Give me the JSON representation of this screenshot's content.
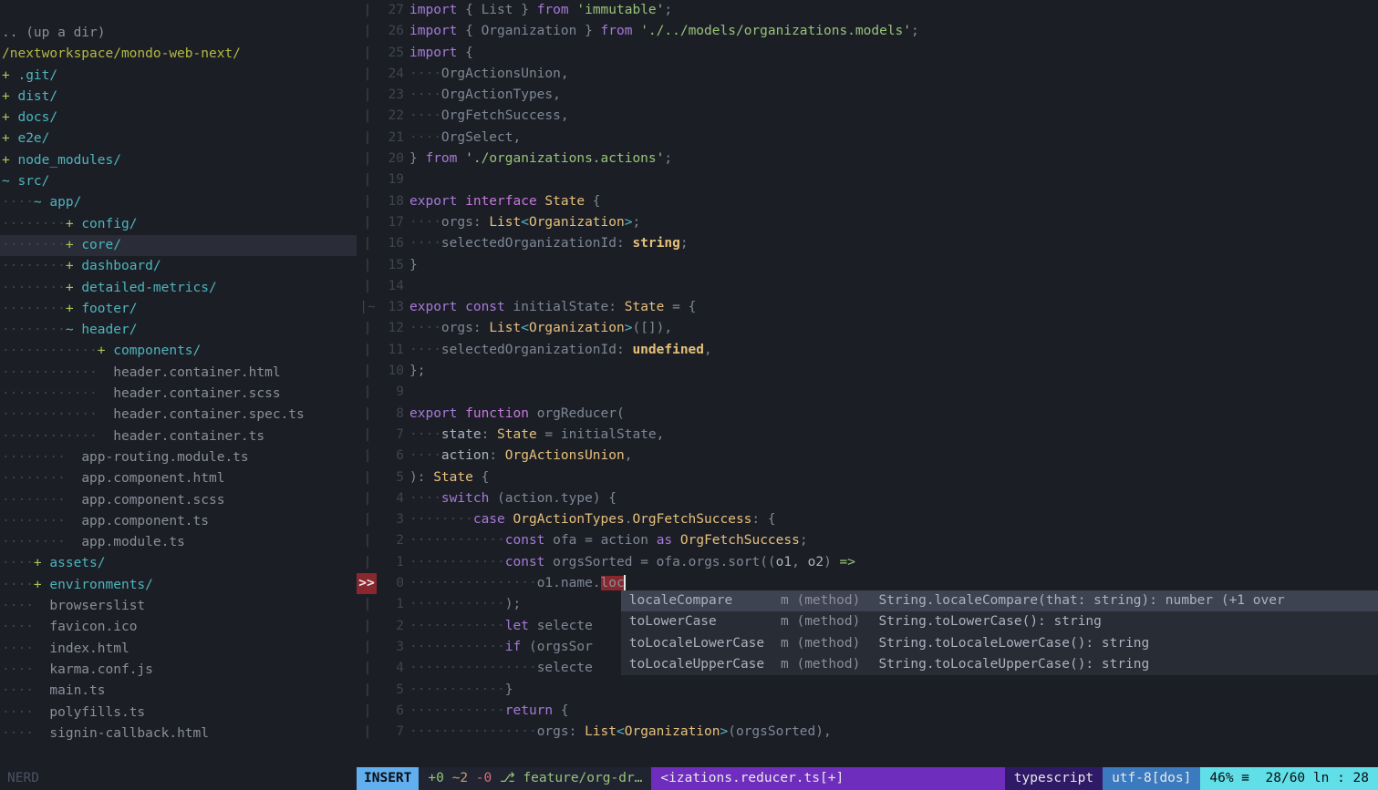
{
  "tree": {
    "updir": ".. (up a dir)",
    "root": "/nextworkspace/mondo-web-next/",
    "items": [
      {
        "indent": 0,
        "mark": "+",
        "name": ".git",
        "suffix": "/",
        "type": "dir"
      },
      {
        "indent": 0,
        "mark": "+",
        "name": "dist",
        "suffix": "/",
        "type": "dir"
      },
      {
        "indent": 0,
        "mark": "+",
        "name": "docs",
        "suffix": "/",
        "type": "dir"
      },
      {
        "indent": 0,
        "mark": "+",
        "name": "e2e",
        "suffix": "/",
        "type": "dir"
      },
      {
        "indent": 0,
        "mark": "+",
        "name": "node_modules",
        "suffix": "/",
        "type": "dir"
      },
      {
        "indent": 0,
        "mark": "~",
        "name": "src",
        "suffix": "/",
        "type": "dir-open"
      },
      {
        "indent": 1,
        "mark": "~",
        "name": "app",
        "suffix": "/",
        "type": "dir-open"
      },
      {
        "indent": 2,
        "mark": "+",
        "name": "config",
        "suffix": "/",
        "type": "dir"
      },
      {
        "indent": 2,
        "mark": "+",
        "name": "core",
        "suffix": "/",
        "type": "dir",
        "selected": true
      },
      {
        "indent": 2,
        "mark": "+",
        "name": "dashboard",
        "suffix": "/",
        "type": "dir"
      },
      {
        "indent": 2,
        "mark": "+",
        "name": "detailed-metrics",
        "suffix": "/",
        "type": "dir"
      },
      {
        "indent": 2,
        "mark": "+",
        "name": "footer",
        "suffix": "/",
        "type": "dir"
      },
      {
        "indent": 2,
        "mark": "~",
        "name": "header",
        "suffix": "/",
        "type": "dir-open"
      },
      {
        "indent": 3,
        "mark": "+",
        "name": "components",
        "suffix": "/",
        "type": "dir"
      },
      {
        "indent": 3,
        "mark": "",
        "name": "header.container.html",
        "suffix": "",
        "type": "file"
      },
      {
        "indent": 3,
        "mark": "",
        "name": "header.container.scss",
        "suffix": "",
        "type": "file"
      },
      {
        "indent": 3,
        "mark": "",
        "name": "header.container.spec.ts",
        "suffix": "",
        "type": "file"
      },
      {
        "indent": 3,
        "mark": "",
        "name": "header.container.ts",
        "suffix": "",
        "type": "file"
      },
      {
        "indent": 2,
        "mark": "",
        "name": "app-routing.module.ts",
        "suffix": "",
        "type": "file"
      },
      {
        "indent": 2,
        "mark": "",
        "name": "app.component.html",
        "suffix": "",
        "type": "file"
      },
      {
        "indent": 2,
        "mark": "",
        "name": "app.component.scss",
        "suffix": "",
        "type": "file"
      },
      {
        "indent": 2,
        "mark": "",
        "name": "app.component.ts",
        "suffix": "",
        "type": "file"
      },
      {
        "indent": 2,
        "mark": "",
        "name": "app.module.ts",
        "suffix": "",
        "type": "file"
      },
      {
        "indent": 1,
        "mark": "+",
        "name": "assets",
        "suffix": "/",
        "type": "dir"
      },
      {
        "indent": 1,
        "mark": "+",
        "name": "environments",
        "suffix": "/",
        "type": "dir"
      },
      {
        "indent": 1,
        "mark": "",
        "name": "browserslist",
        "suffix": "",
        "type": "file"
      },
      {
        "indent": 1,
        "mark": "",
        "name": "favicon.ico",
        "suffix": "",
        "type": "file"
      },
      {
        "indent": 1,
        "mark": "",
        "name": "index.html",
        "suffix": "",
        "type": "file"
      },
      {
        "indent": 1,
        "mark": "",
        "name": "karma.conf.js",
        "suffix": "",
        "type": "file"
      },
      {
        "indent": 1,
        "mark": "",
        "name": "main.ts",
        "suffix": "",
        "type": "file"
      },
      {
        "indent": 1,
        "mark": "",
        "name": "polyfills.ts",
        "suffix": "",
        "type": "file"
      },
      {
        "indent": 1,
        "mark": "",
        "name": "signin-callback.html",
        "suffix": "",
        "type": "file"
      }
    ]
  },
  "code": {
    "lines": [
      {
        "sign": "|",
        "num": "27",
        "tokens": [
          [
            "kw-import",
            "import "
          ],
          [
            "punct",
            "{ "
          ],
          [
            "ident",
            "List"
          ],
          [
            "punct",
            " } "
          ],
          [
            "kw-from",
            "from "
          ],
          [
            "string",
            "'immutable'"
          ],
          [
            "punct",
            ";"
          ]
        ]
      },
      {
        "sign": "|",
        "num": "26",
        "tokens": [
          [
            "kw-import",
            "import "
          ],
          [
            "punct",
            "{ "
          ],
          [
            "ident",
            "Organization"
          ],
          [
            "punct",
            " } "
          ],
          [
            "kw-from",
            "from "
          ],
          [
            "string",
            "'./../models/organizations.models'"
          ],
          [
            "punct",
            ";"
          ]
        ]
      },
      {
        "sign": "|",
        "num": "25",
        "tokens": [
          [
            "kw-import",
            "import "
          ],
          [
            "punct",
            "{"
          ]
        ]
      },
      {
        "sign": "|",
        "num": "24",
        "tokens": [
          [
            "lead",
            "····"
          ],
          [
            "ident",
            "OrgActionsUnion"
          ],
          [
            "punct",
            ","
          ]
        ]
      },
      {
        "sign": "|",
        "num": "23",
        "tokens": [
          [
            "lead",
            "····"
          ],
          [
            "ident",
            "OrgActionTypes"
          ],
          [
            "punct",
            ","
          ]
        ]
      },
      {
        "sign": "|",
        "num": "22",
        "tokens": [
          [
            "lead",
            "····"
          ],
          [
            "ident",
            "OrgFetchSuccess"
          ],
          [
            "punct",
            ","
          ]
        ]
      },
      {
        "sign": "|",
        "num": "21",
        "tokens": [
          [
            "lead",
            "····"
          ],
          [
            "ident",
            "OrgSelect"
          ],
          [
            "punct",
            ","
          ]
        ]
      },
      {
        "sign": "|",
        "num": "20",
        "tokens": [
          [
            "punct",
            "} "
          ],
          [
            "kw-from",
            "from "
          ],
          [
            "string",
            "'./organizations.actions'"
          ],
          [
            "punct",
            ";"
          ]
        ]
      },
      {
        "sign": "|",
        "num": "19",
        "tokens": []
      },
      {
        "sign": "|",
        "num": "18",
        "tokens": [
          [
            "kw-export",
            "export "
          ],
          [
            "kw-interface",
            "interface "
          ],
          [
            "type",
            "State"
          ],
          [
            "punct",
            " {"
          ]
        ]
      },
      {
        "sign": "|",
        "num": "17",
        "tokens": [
          [
            "lead",
            "····"
          ],
          [
            "ident",
            "orgs"
          ],
          [
            "punct",
            ": "
          ],
          [
            "type",
            "List"
          ],
          [
            "lt",
            "<"
          ],
          [
            "type",
            "Organization"
          ],
          [
            "gt",
            ">"
          ],
          [
            "punct",
            ";"
          ]
        ]
      },
      {
        "sign": "|",
        "num": "16",
        "tokens": [
          [
            "lead",
            "····"
          ],
          [
            "ident",
            "selectedOrganizationId"
          ],
          [
            "punct",
            ": "
          ],
          [
            "typekw",
            "string"
          ],
          [
            "punct",
            ";"
          ]
        ]
      },
      {
        "sign": "|",
        "num": "15",
        "tokens": [
          [
            "punct",
            "}"
          ]
        ]
      },
      {
        "sign": "|",
        "num": "14",
        "tokens": []
      },
      {
        "sign": "|~",
        "num": "13",
        "tokens": [
          [
            "kw-export",
            "export "
          ],
          [
            "kw-const",
            "const "
          ],
          [
            "ident",
            "initialState"
          ],
          [
            "punct",
            ": "
          ],
          [
            "type",
            "State"
          ],
          [
            "punct",
            " = {"
          ]
        ]
      },
      {
        "sign": "|",
        "num": "12",
        "tokens": [
          [
            "lead",
            "····"
          ],
          [
            "ident",
            "orgs"
          ],
          [
            "punct",
            ": "
          ],
          [
            "type",
            "List"
          ],
          [
            "lt",
            "<"
          ],
          [
            "type",
            "Organization"
          ],
          [
            "gt",
            ">"
          ],
          [
            "punct",
            "([]),"
          ]
        ]
      },
      {
        "sign": "|",
        "num": "11",
        "tokens": [
          [
            "lead",
            "····"
          ],
          [
            "ident",
            "selectedOrganizationId"
          ],
          [
            "punct",
            ": "
          ],
          [
            "undef",
            "undefined"
          ],
          [
            "punct",
            ","
          ]
        ]
      },
      {
        "sign": "|",
        "num": "10",
        "tokens": [
          [
            "punct",
            "};"
          ]
        ]
      },
      {
        "sign": "|",
        "num": "9",
        "tokens": []
      },
      {
        "sign": "|",
        "num": "8",
        "tokens": [
          [
            "kw-export",
            "export "
          ],
          [
            "kw-function",
            "function "
          ],
          [
            "ident",
            "orgReducer"
          ],
          [
            "punct",
            "("
          ]
        ]
      },
      {
        "sign": "|",
        "num": "7",
        "tokens": [
          [
            "lead",
            "····"
          ],
          [
            "param",
            "state"
          ],
          [
            "punct",
            ": "
          ],
          [
            "type",
            "State"
          ],
          [
            "punct",
            " = "
          ],
          [
            "ident",
            "initialState"
          ],
          [
            "punct",
            ","
          ]
        ]
      },
      {
        "sign": "|",
        "num": "6",
        "tokens": [
          [
            "lead",
            "····"
          ],
          [
            "param",
            "action"
          ],
          [
            "punct",
            ": "
          ],
          [
            "type",
            "OrgActionsUnion"
          ],
          [
            "punct",
            ","
          ]
        ]
      },
      {
        "sign": "|",
        "num": "5",
        "tokens": [
          [
            "punct",
            "): "
          ],
          [
            "type",
            "State"
          ],
          [
            "punct",
            " {"
          ]
        ]
      },
      {
        "sign": "|",
        "num": "4",
        "tokens": [
          [
            "lead",
            "····"
          ],
          [
            "kw-switch",
            "switch"
          ],
          [
            "punct",
            " ("
          ],
          [
            "ident",
            "action"
          ],
          [
            "punct",
            "."
          ],
          [
            "ident",
            "type"
          ],
          [
            "punct",
            ") {"
          ]
        ]
      },
      {
        "sign": "|",
        "num": "3",
        "tokens": [
          [
            "lead",
            "········"
          ],
          [
            "kw-case",
            "case"
          ],
          [
            "punct",
            " "
          ],
          [
            "type",
            "OrgActionTypes"
          ],
          [
            "punct",
            "."
          ],
          [
            "type",
            "OrgFetchSuccess"
          ],
          [
            "punct",
            ": {"
          ]
        ]
      },
      {
        "sign": "|",
        "num": "2",
        "tokens": [
          [
            "lead",
            "············"
          ],
          [
            "kw-const",
            "const "
          ],
          [
            "ident",
            "ofa"
          ],
          [
            "punct",
            " = "
          ],
          [
            "ident",
            "action"
          ],
          [
            "punct",
            " "
          ],
          [
            "kw-as",
            "as"
          ],
          [
            "punct",
            " "
          ],
          [
            "type",
            "OrgFetchSuccess"
          ],
          [
            "punct",
            ";"
          ]
        ]
      },
      {
        "sign": "|",
        "num": "1",
        "tokens": [
          [
            "lead",
            "············"
          ],
          [
            "kw-const",
            "const "
          ],
          [
            "ident",
            "orgsSorted"
          ],
          [
            "punct",
            " = "
          ],
          [
            "ident",
            "ofa"
          ],
          [
            "punct",
            "."
          ],
          [
            "ident",
            "orgs"
          ],
          [
            "punct",
            "."
          ],
          [
            "ident",
            "sort"
          ],
          [
            "punct",
            "(("
          ],
          [
            "param",
            "o1"
          ],
          [
            "punct",
            ", "
          ],
          [
            "param",
            "o2"
          ],
          [
            "punct",
            ") "
          ],
          [
            "op",
            "=>"
          ]
        ]
      },
      {
        "sign": ">>",
        "signClass": "sign-err",
        "num": "0",
        "tokens": [
          [
            "lead",
            "················"
          ],
          [
            "ident",
            "o1"
          ],
          [
            "punct",
            "."
          ],
          [
            "ident",
            "name"
          ],
          [
            "punct",
            "."
          ],
          [
            "cursor-bg",
            "loc"
          ],
          [
            "cursor",
            ""
          ]
        ]
      },
      {
        "sign": "|",
        "num": "1",
        "tokens": [
          [
            "lead",
            "············"
          ],
          [
            "punct",
            ");"
          ]
        ]
      },
      {
        "sign": "|",
        "num": "2",
        "tokens": [
          [
            "lead",
            "············"
          ],
          [
            "kw-let",
            "let "
          ],
          [
            "ident",
            "selecte"
          ]
        ]
      },
      {
        "sign": "|",
        "num": "3",
        "tokens": [
          [
            "lead",
            "············"
          ],
          [
            "kw-if",
            "if"
          ],
          [
            "punct",
            " ("
          ],
          [
            "ident",
            "orgsSor"
          ]
        ]
      },
      {
        "sign": "|",
        "num": "4",
        "tokens": [
          [
            "lead",
            "················"
          ],
          [
            "ident",
            "selecte"
          ]
        ]
      },
      {
        "sign": "|",
        "num": "5",
        "tokens": [
          [
            "lead",
            "············"
          ],
          [
            "punct",
            "}"
          ]
        ]
      },
      {
        "sign": "|",
        "num": "6",
        "tokens": [
          [
            "lead",
            "············"
          ],
          [
            "kw-return",
            "return"
          ],
          [
            "punct",
            " {"
          ]
        ]
      },
      {
        "sign": "|",
        "num": "7",
        "tokens": [
          [
            "lead",
            "················"
          ],
          [
            "ident",
            "orgs"
          ],
          [
            "punct",
            ": "
          ],
          [
            "type",
            "List"
          ],
          [
            "lt",
            "<"
          ],
          [
            "type",
            "Organization"
          ],
          [
            "gt",
            ">"
          ],
          [
            "punct",
            "("
          ],
          [
            "ident",
            "orgsSorted"
          ],
          [
            "punct",
            "),"
          ]
        ]
      }
    ]
  },
  "popup": {
    "items": [
      {
        "name": "localeCompare",
        "kind": "m (method)",
        "sig": "String.localeCompare(that: string): number (+1 over",
        "hl": true
      },
      {
        "name": "toLowerCase",
        "kind": "m (method)",
        "sig": "String.toLowerCase(): string"
      },
      {
        "name": "toLocaleLowerCase",
        "kind": "m (method)",
        "sig": "String.toLocaleLowerCase(): string"
      },
      {
        "name": "toLocaleUpperCase",
        "kind": "m (method)",
        "sig": "String.toLocaleUpperCase(): string"
      }
    ]
  },
  "status": {
    "nerd": "NERD",
    "mode": "INSERT",
    "diff_plus": "+0",
    "diff_tilde": "~2",
    "diff_minus": "-0",
    "branch_glyph": "⎇",
    "branch": "feature/org-dr…",
    "file": "<izations.reducer.ts[+]",
    "filetype": "typescript",
    "encoding": "utf-8[dos]",
    "percent": "46% ≡",
    "pos": "28/60 ln : 28"
  }
}
